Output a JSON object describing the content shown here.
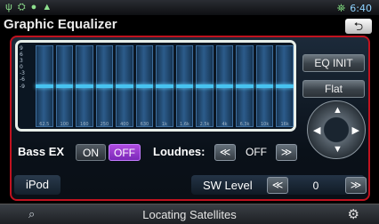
{
  "statusbar": {
    "icons": [
      "ψ",
      "⛭",
      "●",
      "▲"
    ],
    "time": "6:40"
  },
  "title": "Graphic Equalizer",
  "eq": {
    "scale": [
      "9",
      "6",
      "3",
      "0",
      "-3",
      "-6",
      "-9"
    ],
    "band_levels": [
      0,
      0,
      0,
      0,
      0,
      0,
      0,
      0,
      0,
      0,
      0,
      0,
      0
    ],
    "frequencies": [
      "62.5",
      "100",
      "160",
      "250",
      "400",
      "630",
      "1k",
      "1.6k",
      "2.5k",
      "4k",
      "6.3k",
      "10k",
      "16k"
    ]
  },
  "buttons": {
    "eq_init": "EQ INIT",
    "flat": "Flat"
  },
  "bass_ex": {
    "label": "Bass EX",
    "on": "ON",
    "off": "OFF"
  },
  "loudness": {
    "label": "Loudnes:",
    "value": "OFF",
    "prev": "≪",
    "next": "≫"
  },
  "source": "iPod",
  "sw_level": {
    "label": "SW Level",
    "value": "0",
    "prev": "≪",
    "next": "≫"
  },
  "bottombar": {
    "status": "Locating Satellites"
  }
}
